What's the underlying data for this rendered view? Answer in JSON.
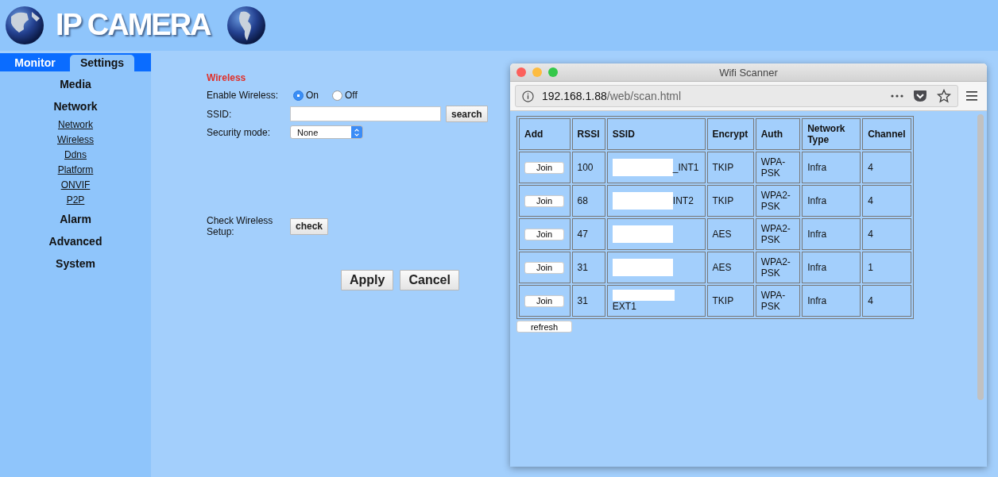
{
  "header": {
    "title": "IP CAMERA"
  },
  "tabs": [
    {
      "label": "Monitor",
      "selected": false
    },
    {
      "label": "Settings",
      "selected": true
    }
  ],
  "sidebar": {
    "items": [
      {
        "label": "Media",
        "kind": "section"
      },
      {
        "label": "Network",
        "kind": "section",
        "children": [
          {
            "label": "Network"
          },
          {
            "label": "Wireless"
          },
          {
            "label": "Ddns"
          },
          {
            "label": "Platform"
          },
          {
            "label": "ONVIF"
          },
          {
            "label": "P2P"
          }
        ]
      },
      {
        "label": "Alarm",
        "kind": "section"
      },
      {
        "label": "Advanced",
        "kind": "section"
      },
      {
        "label": "System",
        "kind": "section"
      }
    ]
  },
  "form": {
    "title": "Wireless",
    "enable": {
      "label": "Enable Wireless:",
      "options": [
        {
          "label": "On",
          "selected": true
        },
        {
          "label": "Off",
          "selected": false
        }
      ]
    },
    "ssid": {
      "label": "SSID:",
      "button": "search"
    },
    "security": {
      "label": "Security mode:",
      "value": "None"
    },
    "check": {
      "label": "Check Wireless Setup:",
      "button": "check"
    },
    "buttons": [
      "Apply",
      "Cancel"
    ]
  },
  "popup": {
    "title": "Wifi Scanner",
    "url_host": "192.168.1.88",
    "url_path": "/web/scan.html",
    "table": {
      "columns": [
        "Add",
        "RSSI",
        "SSID",
        "Encrypt",
        "Auth",
        "Network Type",
        "Channel"
      ],
      "rows": [
        {
          "button": "Join",
          "rssi": "100",
          "ssid": "_INT1",
          "kind": "inline",
          "encrypt": "TKIP",
          "auth": "WPA-PSK",
          "type": "Infra",
          "channel": "4"
        },
        {
          "button": "Join",
          "rssi": "68",
          "ssid": "INT2",
          "kind": "inline",
          "encrypt": "TKIP",
          "auth": "WPA2-PSK",
          "type": "Infra",
          "channel": "4"
        },
        {
          "button": "Join",
          "rssi": "47",
          "kind": "inline",
          "encrypt": "AES",
          "auth": "WPA2-PSK",
          "type": "Infra",
          "channel": "4"
        },
        {
          "button": "Join",
          "rssi": "31",
          "kind": "inline",
          "encrypt": "AES",
          "auth": "WPA2-PSK",
          "type": "Infra",
          "channel": "1"
        },
        {
          "button": "Join",
          "rssi": "31",
          "ssid": "EXT1",
          "kind": "stacked",
          "encrypt": "TKIP",
          "auth": "WPA-PSK",
          "type": "Infra",
          "channel": "4"
        }
      ]
    },
    "refresh": "refresh"
  }
}
